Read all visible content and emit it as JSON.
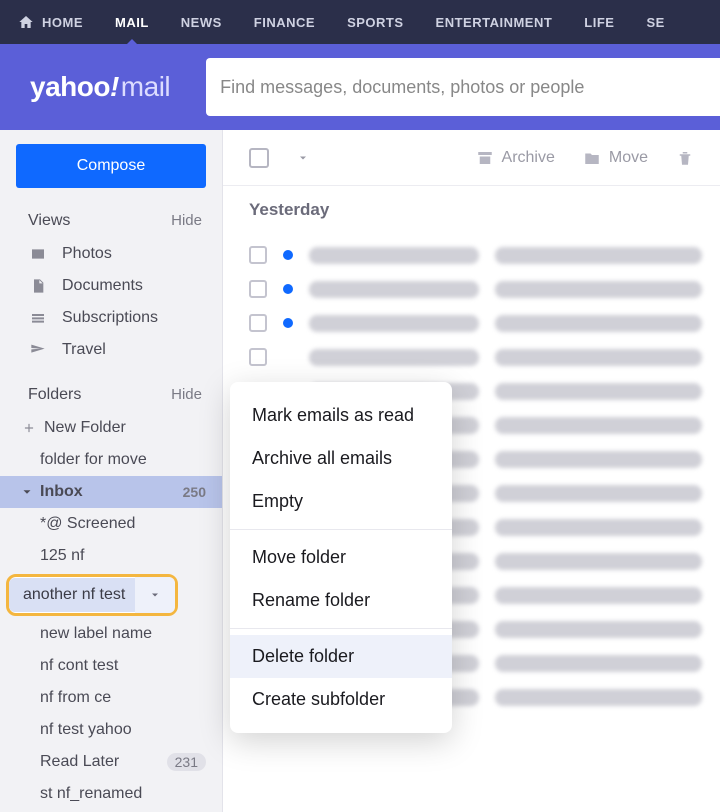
{
  "topnav": {
    "items": [
      "HOME",
      "MAIL",
      "NEWS",
      "FINANCE",
      "SPORTS",
      "ENTERTAINMENT",
      "LIFE",
      "SE"
    ],
    "active_index": 1
  },
  "logo": {
    "yahoo": "yahoo",
    "excl": "!",
    "mail": "mail"
  },
  "search": {
    "placeholder": "Find messages, documents, photos or people"
  },
  "compose_label": "Compose",
  "views": {
    "head": "Views",
    "hide": "Hide",
    "items": [
      "Photos",
      "Documents",
      "Subscriptions",
      "Travel"
    ]
  },
  "folders": {
    "head": "Folders",
    "hide": "Hide",
    "new_folder": "New Folder",
    "list": [
      {
        "name": "folder for move"
      },
      {
        "name": "Inbox",
        "count": "250",
        "inbox": true
      },
      {
        "name": "*@ Screened"
      },
      {
        "name": "125 nf"
      },
      {
        "name": "another nf test",
        "selected": true
      },
      {
        "name": "new label name"
      },
      {
        "name": "nf cont test"
      },
      {
        "name": "nf from ce"
      },
      {
        "name": "nf test yahoo"
      },
      {
        "name": "Read Later",
        "count": "231",
        "pill": true
      },
      {
        "name": "st nf_renamed"
      }
    ]
  },
  "toolbar": {
    "archive": "Archive",
    "move": "Move"
  },
  "date_header": "Yesterday",
  "context_menu": {
    "items": [
      "Mark emails as read",
      "Archive all emails",
      "Empty",
      "Move folder",
      "Rename folder",
      "Delete folder",
      "Create subfolder"
    ],
    "highlight_index": 5,
    "separators_after": [
      2,
      4
    ]
  }
}
